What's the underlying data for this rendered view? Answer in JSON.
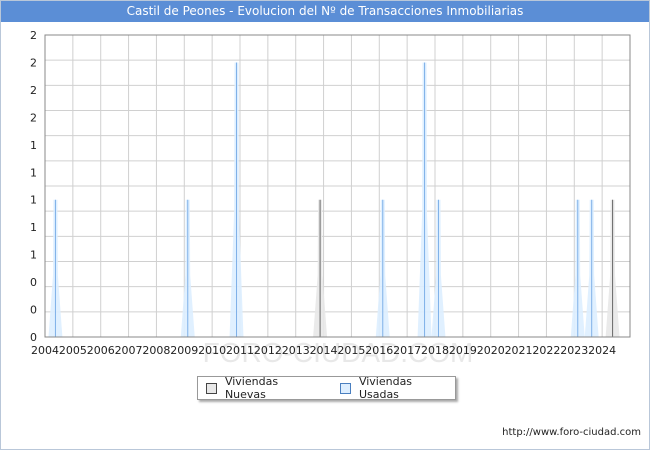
{
  "title": "Castil de Peones - Evolucion del Nº de Transacciones Inmobiliarias",
  "footer_url": "http://www.foro-ciudad.com",
  "watermark": "FORO-CIUDAD.COM",
  "colors": {
    "title_bg": "#5b8ed6",
    "nuevas_fill": "#e8e8e8",
    "nuevas_stroke": "#666666",
    "usadas_fill": "#ddeeff",
    "usadas_stroke": "#7fb0e8",
    "grid": "#d0d0d0"
  },
  "chart_data": {
    "type": "area",
    "title": "Castil de Peones - Evolucion del Nº de Transacciones Inmobiliarias",
    "xlabel": "",
    "ylabel": "",
    "x_tick_labels": [
      "2004",
      "2005",
      "2006",
      "2007",
      "2008",
      "2009",
      "2010",
      "2011",
      "2012",
      "2013",
      "2014",
      "2015",
      "2016",
      "2017",
      "2018",
      "2019",
      "2020",
      "2021",
      "2022",
      "2023",
      "2024"
    ],
    "y_tick_labels": [
      "0",
      "0",
      "0",
      "1",
      "1",
      "1",
      "1",
      "1",
      "2",
      "2",
      "2",
      "2"
    ],
    "ylim": [
      0,
      2.2
    ],
    "grid": true,
    "legend_position": "bottom",
    "series": [
      {
        "name": "Viviendas Nuevas",
        "color": "#666666",
        "points": [
          {
            "x": "2013Q4",
            "y": 1
          },
          {
            "x": "2024Q2",
            "y": 1
          }
        ]
      },
      {
        "name": "Viviendas Usadas",
        "color": "#7fb0e8",
        "points": [
          {
            "x": "2004Q2",
            "y": 1
          },
          {
            "x": "2009Q1",
            "y": 1
          },
          {
            "x": "2010Q4",
            "y": 2
          },
          {
            "x": "2016Q1",
            "y": 1
          },
          {
            "x": "2017Q3",
            "y": 2
          },
          {
            "x": "2018Q1",
            "y": 1
          },
          {
            "x": "2023Q1",
            "y": 1
          },
          {
            "x": "2023Q3",
            "y": 1
          }
        ]
      }
    ]
  },
  "legend": {
    "nuevas_label": "Viviendas Nuevas",
    "usadas_label": "Viviendas Usadas"
  }
}
